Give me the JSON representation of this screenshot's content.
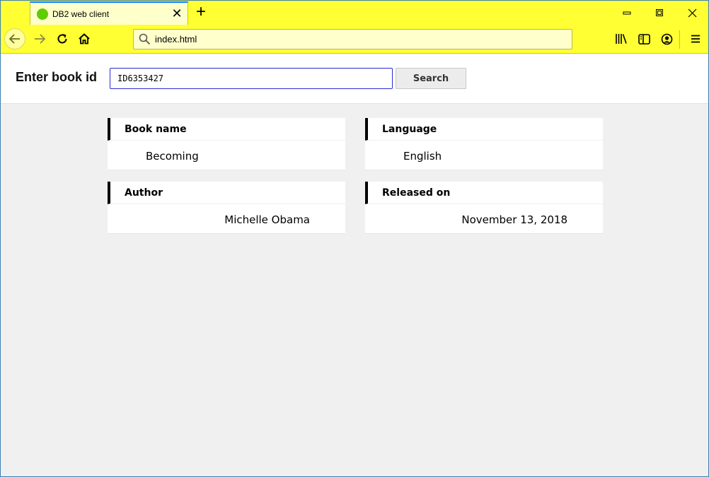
{
  "browser": {
    "tab": {
      "title": "DB2 web client",
      "close": "✕"
    },
    "new_tab": "+",
    "url": "index.html",
    "icons": [
      "back-icon",
      "forward-icon",
      "reload-icon",
      "home-icon",
      "search-icon",
      "library-icon",
      "sidebar-icon",
      "account-icon",
      "menu-icon",
      "minimize-icon",
      "maximize-icon",
      "close-icon"
    ],
    "accent_color": "#ffff33"
  },
  "search": {
    "label": "Enter book id",
    "value": "ID6353427",
    "button": "Search"
  },
  "fields": {
    "book_name": {
      "label": "Book name",
      "value": "Becoming"
    },
    "language": {
      "label": "Language",
      "value": "English"
    },
    "author": {
      "label": "Author",
      "value": "Michelle Obama"
    },
    "released_on": {
      "label": "Released on",
      "value": "November 13, 2018"
    }
  }
}
